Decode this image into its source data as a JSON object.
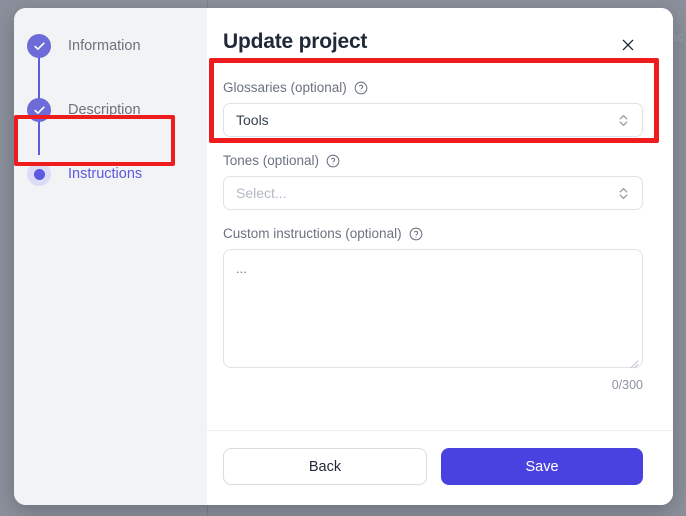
{
  "backdrop": {
    "page_text": "ac"
  },
  "sidebar": {
    "steps": [
      {
        "label": "Information",
        "state": "done",
        "icon": "check-icon"
      },
      {
        "label": "Description",
        "state": "done",
        "icon": "check-icon"
      },
      {
        "label": "Instructions",
        "state": "current",
        "icon": "dot-icon"
      }
    ]
  },
  "header": {
    "title": "Update project",
    "close_icon": "close-icon"
  },
  "form": {
    "glossaries": {
      "label": "Glossaries (optional)",
      "help_icon": "help-circle-icon",
      "value": "Tools",
      "chevron_icon": "chevron-up-down-icon"
    },
    "tones": {
      "label": "Tones (optional)",
      "help_icon": "help-circle-icon",
      "placeholder": "Select...",
      "chevron_icon": "chevron-up-down-icon"
    },
    "custom_instructions": {
      "label": "Custom instructions (optional)",
      "help_icon": "help-circle-icon",
      "placeholder": "...",
      "char_count": "0/300",
      "resize_icon": "resize-handle-icon"
    }
  },
  "footer": {
    "back_label": "Back",
    "save_label": "Save"
  },
  "colors": {
    "accent": "#5b5ae0",
    "save_button": "#4a42e0",
    "highlight": "#ee1c1c",
    "sidebar_bg": "#f2f3f5",
    "backdrop": "#8b909c"
  }
}
